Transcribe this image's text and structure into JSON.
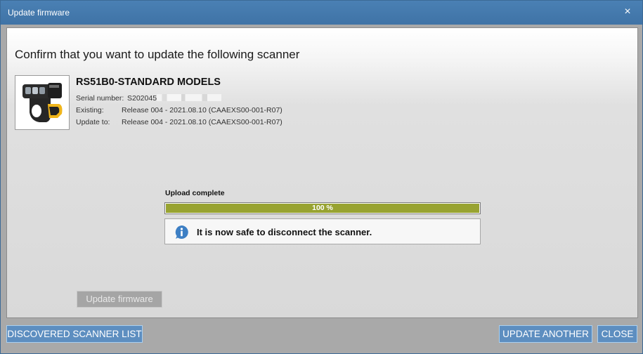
{
  "window": {
    "title": "Update firmware",
    "close_glyph": "×"
  },
  "dialog": {
    "heading": "Confirm that you want to update the following scanner",
    "scanner": {
      "model": "RS51B0-STANDARD MODELS",
      "serial_label": "Serial number:",
      "serial_value": "S202045",
      "existing_label": "Existing:",
      "existing_value": "Release 004 - 2021.08.10 (CAAEXS00-001-R07)",
      "update_label": "Update to:",
      "update_value": "Release 004 - 2021.08.10 (CAAEXS00-001-R07)"
    },
    "progress": {
      "label": "Upload complete",
      "percent": 100,
      "percent_text": "100 %"
    },
    "notice": {
      "icon": "info-icon",
      "message": "It is now safe to disconnect the scanner."
    },
    "update_button": "Update firmware"
  },
  "footer": {
    "discovered_button": "DISCOVERED SCANNER LIST",
    "update_another_button": "UPDATE ANOTHER",
    "close_button": "CLOSE"
  },
  "colors": {
    "titlebar": "#4a80b4",
    "progress_fill": "#98a331",
    "button": "#5d8ec0",
    "info_icon": "#3d7fc4"
  }
}
